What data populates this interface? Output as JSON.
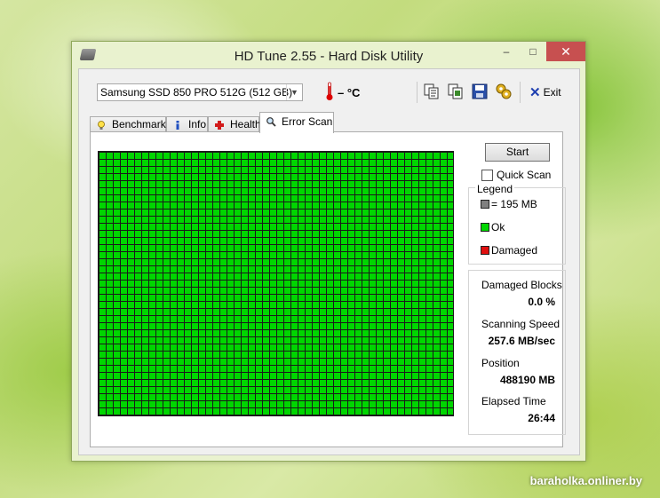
{
  "window": {
    "title": "HD Tune 2.55 - Hard Disk Utility",
    "controls": {
      "minimize": "–",
      "maximize": "□",
      "close": "✕"
    }
  },
  "toolbar": {
    "drive": "Samsung SSD 850 PRO 512G (512 GB)",
    "temperature": "– °C",
    "icons": [
      "copy-text-icon",
      "copy-screenshot-icon",
      "save-icon",
      "options-icon"
    ],
    "exit_label": "Exit"
  },
  "tabs": [
    {
      "label": "Benchmark",
      "icon": "lightbulb-icon",
      "active": false
    },
    {
      "label": "Info",
      "icon": "info-icon",
      "active": false
    },
    {
      "label": "Health",
      "icon": "health-cross-icon",
      "active": false
    },
    {
      "label": "Error Scan",
      "icon": "magnifier-icon",
      "active": true
    }
  ],
  "error_scan": {
    "start_label": "Start",
    "quick_scan_label": "Quick Scan",
    "quick_scan_checked": false,
    "legend": {
      "title": "Legend",
      "items": [
        {
          "label": "= 195 MB",
          "color": "#808080"
        },
        {
          "label": "Ok",
          "color": "#00d600"
        },
        {
          "label": "Damaged",
          "color": "#e01010"
        }
      ]
    },
    "stats": {
      "damaged_blocks_label": "Damaged Blocks",
      "damaged_blocks_value": "0.0 %",
      "scanning_speed_label": "Scanning Speed",
      "scanning_speed_value": "257.6 MB/sec",
      "position_label": "Position",
      "position_value": "488190 MB",
      "elapsed_time_label": "Elapsed Time",
      "elapsed_time_value": "26:44"
    },
    "grid_color": "#00d600",
    "all_blocks_status": "Ok"
  },
  "watermark": "baraholka.onliner.by"
}
